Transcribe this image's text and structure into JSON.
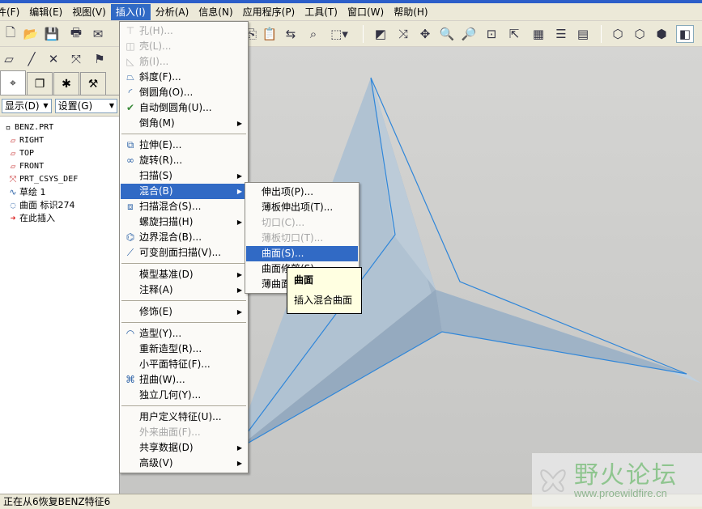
{
  "menubar": {
    "items": [
      "文件(F)",
      "编辑(E)",
      "视图(V)",
      "插入(I)",
      "分析(A)",
      "信息(N)",
      "应用程序(P)",
      "工具(T)",
      "窗口(W)",
      "帮助(H)"
    ],
    "file": "件(F)",
    "edit": "编辑(E)",
    "view": "视图(V)",
    "insert": "插入(I)",
    "analysis": "分析(A)",
    "info": "信息(N)",
    "applications": "应用程序(P)",
    "tools": "工具(T)",
    "window": "窗口(W)",
    "help": "帮助(H)"
  },
  "navigator": {
    "show_label": "显示(D)",
    "settings_label": "设置(G)",
    "tree": {
      "root": "BENZ.PRT",
      "right": "RIGHT",
      "top": "TOP",
      "front": "FRONT",
      "csys": "PRT_CSYS_DEF",
      "sketch": "草绘 1",
      "surface": "曲面 标识274",
      "insert_here": "在此插入"
    }
  },
  "insert_menu": {
    "hole": "孔(H)...",
    "shell": "壳(L)...",
    "rib": "筋(I)...",
    "draft": "斜度(F)...",
    "round": "倒圆角(O)...",
    "auto_round": "自动倒圆角(U)...",
    "chamfer": "倒角(M)",
    "extrude": "拉伸(E)...",
    "revolve": "旋转(R)...",
    "sweep": "扫描(S)",
    "blend": "混合(B)",
    "swept_blend": "扫描混合(S)...",
    "helical_sweep": "螺旋扫描(H)",
    "boundary_blend": "边界混合(B)...",
    "var_sec_sweep": "可变剖面扫描(V)...",
    "model_datum": "模型基准(D)",
    "annotation": "注释(A)",
    "cosmetic": "修饰(E)",
    "style": "造型(Y)...",
    "restyle": "重新造型(R)...",
    "flat_feature": "小平面特征(F)...",
    "warp": "扭曲(W)...",
    "independent_geom": "独立几何(Y)...",
    "udf": "用户定义特征(U)...",
    "shared_data": "外来曲面(F)...",
    "shared_data_menu": "共享数据(D)",
    "advanced": "高级(V)"
  },
  "blend_menu": {
    "protrusion": "伸出项(P)...",
    "thin_protrusion": "薄板伸出项(T)...",
    "cut": "切口(C)...",
    "thin_cut": "薄板切口(T)...",
    "surface": "曲面(S)...",
    "surface_trim": "曲面修剪(S)",
    "thin_surface_trim": "薄曲面"
  },
  "tooltip": {
    "title": "曲面",
    "body": "插入混合曲面"
  },
  "status": {
    "message": "正在从6恢复BENZ特征6"
  },
  "watermark": {
    "title": "野火论坛",
    "url": "www.proewildfire.cn"
  },
  "colors": {
    "highlight": "#316ac5",
    "model_fill": "#a9bccd",
    "model_edge": "#2f86d9"
  }
}
